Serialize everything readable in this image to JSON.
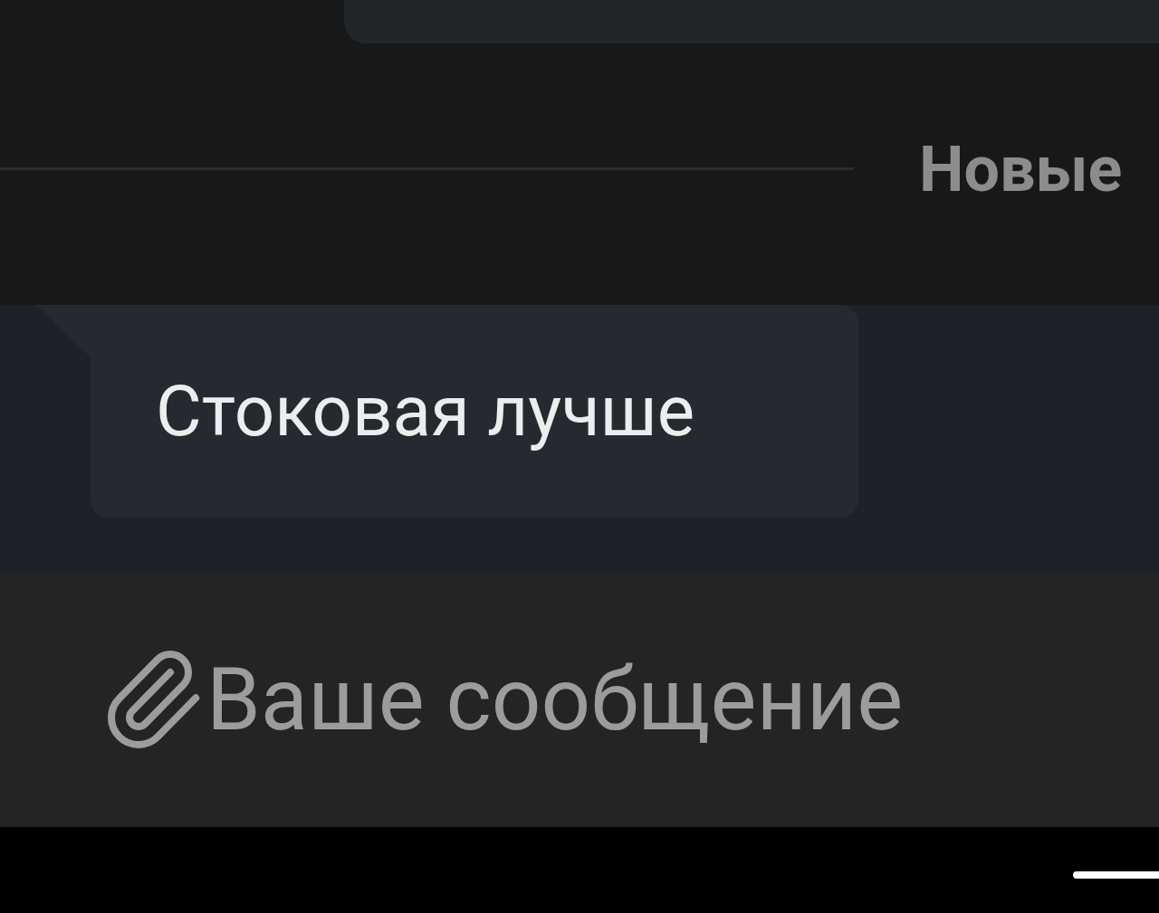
{
  "divider": {
    "label": "Новые"
  },
  "messages": [
    {
      "text": "Стоковая лучше",
      "highlighted": true
    }
  ],
  "composer": {
    "placeholder": "Ваше сообщение"
  }
}
